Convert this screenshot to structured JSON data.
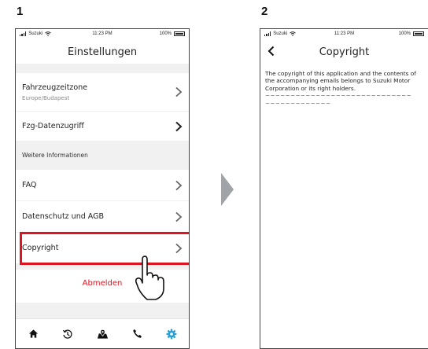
{
  "steps": [
    "1",
    "2"
  ],
  "status": {
    "carrier": "Suzuki",
    "time": "11:23 PM",
    "battery": "100%"
  },
  "screen1": {
    "title": "Einstellungen",
    "rows": [
      {
        "label": "Fahrzeugzeitzone",
        "value": "Europe/Budapest"
      },
      {
        "label": "Fzg-Datenzugriff"
      }
    ],
    "section_header": "Weitere Informationen",
    "info_rows": [
      {
        "label": "FAQ"
      },
      {
        "label": "Datenschutz und AGB"
      },
      {
        "label": "Copyright"
      }
    ],
    "logout_label": "Abmelden",
    "tabs": [
      "home-icon",
      "history-icon",
      "map-icon",
      "phone-icon",
      "settings-icon"
    ],
    "accent": "#2a9fd6",
    "highlight_color": "#e0141f"
  },
  "screen2": {
    "title": "Copyright",
    "body": "The copyright of this application and the contents of the accompanying emails belongs to Suzuki Motor Corporation or its right holders.",
    "tilde_line_1": "~~~~~~~~~~~~~~~~~~~~~~~~~~~~~",
    "tilde_line_2": "~~~~~~~~~~~~~"
  }
}
